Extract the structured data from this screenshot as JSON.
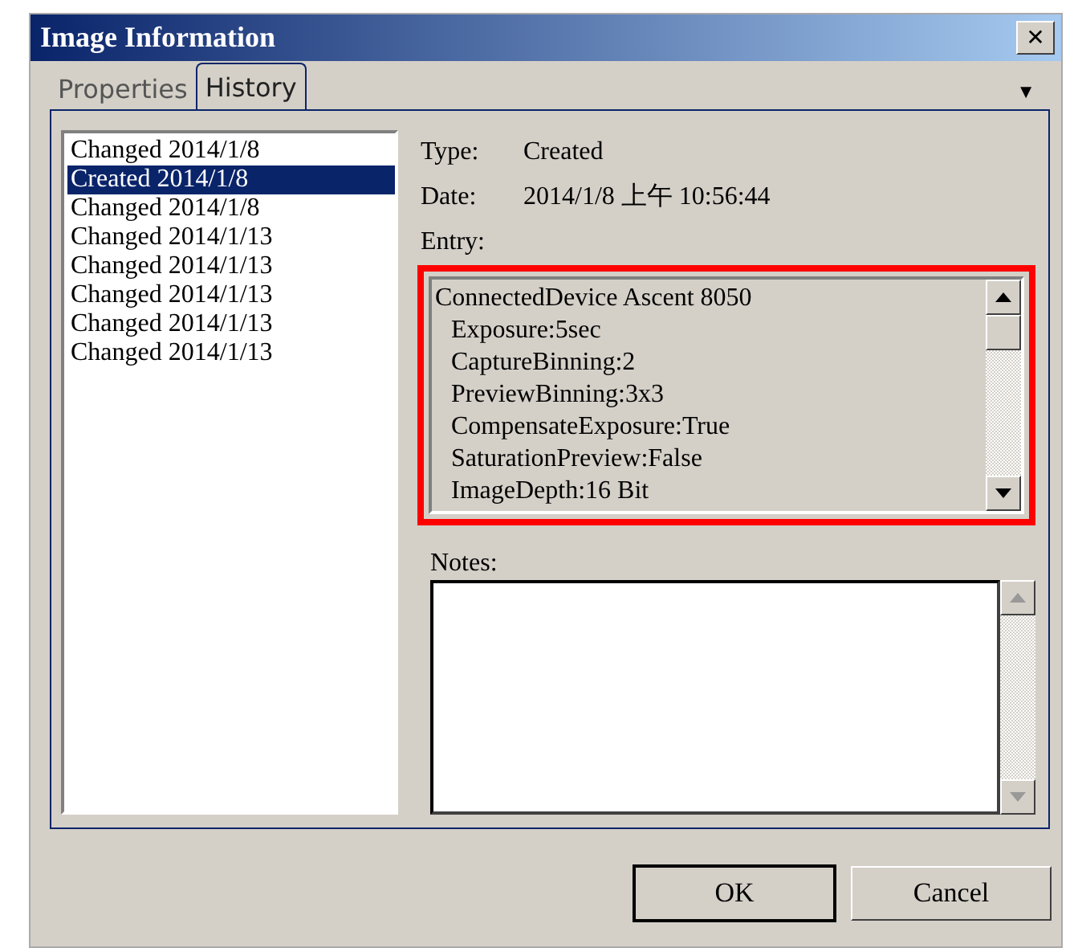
{
  "window": {
    "title": "Image Information",
    "close": "✕"
  },
  "tabs": [
    {
      "label": "Properties",
      "selected": false
    },
    {
      "label": "History",
      "selected": true
    }
  ],
  "tab_menu": "▼",
  "history": [
    {
      "label": "Changed 2014/1/8",
      "selected": false
    },
    {
      "label": "Created 2014/1/8",
      "selected": true
    },
    {
      "label": "Changed 2014/1/8",
      "selected": false
    },
    {
      "label": "Changed 2014/1/13",
      "selected": false
    },
    {
      "label": "Changed 2014/1/13",
      "selected": false
    },
    {
      "label": "Changed 2014/1/13",
      "selected": false
    },
    {
      "label": "Changed 2014/1/13",
      "selected": false
    },
    {
      "label": "Changed 2014/1/13",
      "selected": false
    }
  ],
  "details": [
    {
      "label": "Type:",
      "value": "Created"
    },
    {
      "label": "Date:",
      "value": "2014/1/8 上午 10:56:44"
    }
  ],
  "entry": {
    "label": "Entry:",
    "highlighted": true,
    "lines": [
      {
        "text": "ConnectedDevice Ascent 8050",
        "children": [
          {
            "text": "Exposure:5sec"
          },
          {
            "text": "CaptureBinning:2"
          },
          {
            "text": "PreviewBinning:3x3"
          },
          {
            "text": "CompensateExposure:True"
          },
          {
            "text": "SaturationPreview:False"
          },
          {
            "text": "ImageDepth:16 Bit"
          }
        ]
      }
    ]
  },
  "notes": {
    "label": "Notes:"
  },
  "buttons": [
    "OK",
    "Cancel"
  ]
}
